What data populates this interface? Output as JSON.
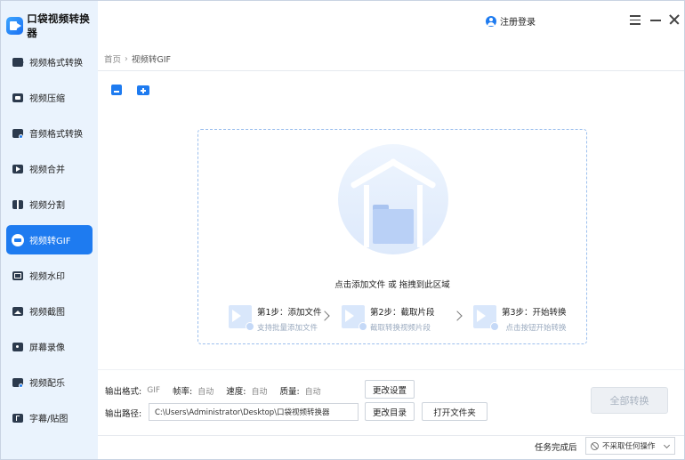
{
  "app": {
    "title": "口袋视频转换器",
    "accent_color": "#1e7bf0"
  },
  "header": {
    "login_label": "注册登录",
    "icons": [
      "user-icon",
      "menu-icon",
      "minimize-icon",
      "close-icon"
    ]
  },
  "sidebar": {
    "items": [
      {
        "label": "视频格式转换",
        "icon": "video-format-icon"
      },
      {
        "label": "视频压缩",
        "icon": "video-compress-icon"
      },
      {
        "label": "音频格式转换",
        "icon": "audio-format-icon"
      },
      {
        "label": "视频合并",
        "icon": "video-merge-icon"
      },
      {
        "label": "视频分割",
        "icon": "video-split-icon"
      },
      {
        "label": "视频转GIF",
        "icon": "gif-icon",
        "active": true
      },
      {
        "label": "视频水印",
        "icon": "watermark-icon"
      },
      {
        "label": "视频截图",
        "icon": "screenshot-icon"
      },
      {
        "label": "屏幕录像",
        "icon": "screen-record-icon"
      },
      {
        "label": "视频配乐",
        "icon": "music-icon"
      },
      {
        "label": "字幕/贴图",
        "icon": "subtitle-icon"
      }
    ]
  },
  "breadcrumb": {
    "home": "首页",
    "separator": "›",
    "current": "视频转GIF"
  },
  "dropzone": {
    "hint": "点击添加文件 或 拖拽到此区域",
    "steps": [
      {
        "title": "第1步：添加文件",
        "subtitle": "支持批量添加文件"
      },
      {
        "title": "第2步：截取片段",
        "subtitle": "截取转换视频片段"
      },
      {
        "title": "第3步：开始转换",
        "subtitle": "点击按钮开始转换"
      }
    ]
  },
  "settings": {
    "format_label": "输出格式:",
    "format_value": "GIF",
    "framerate_label": "帧率:",
    "framerate_value": "自动",
    "speed_label": "速度:",
    "speed_value": "自动",
    "quality_label": "质量:",
    "quality_value": "自动",
    "change_settings_button": "更改设置",
    "path_label": "输出路径:",
    "path_value": "C:\\Users\\Administrator\\Desktop\\口袋视频转换器",
    "change_dir_button": "更改目录",
    "open_folder_button": "打开文件夹",
    "convert_all_button": "全部转换"
  },
  "footer": {
    "after_complete_label": "任务完成后",
    "after_complete_value": "不采取任何操作"
  }
}
